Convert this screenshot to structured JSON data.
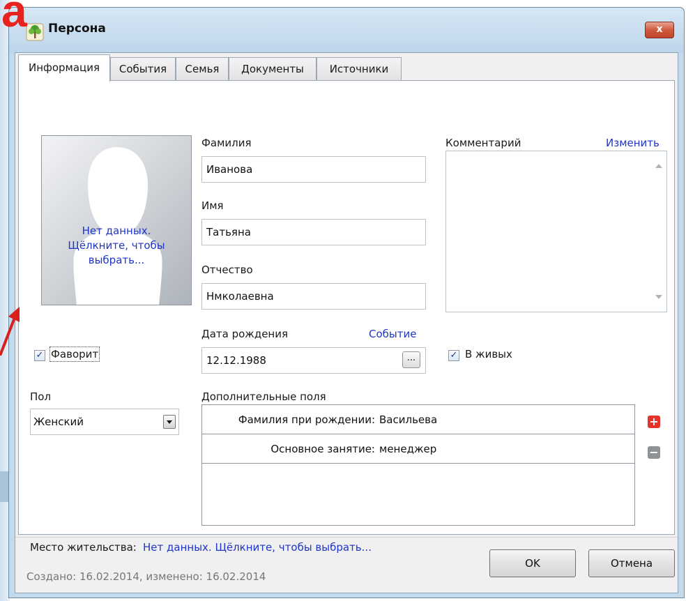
{
  "slide": {
    "corner_letter": "а"
  },
  "window": {
    "title": "Персона",
    "close_label": "x"
  },
  "tabs": [
    "Информация",
    "События",
    "Семья",
    "Документы",
    "Источники"
  ],
  "photo": {
    "line1": "Нет данных.",
    "line2": "Щёлкните, чтобы",
    "line3": "выбрать..."
  },
  "form": {
    "surname_label": "Фамилия",
    "surname_value": "Иванова",
    "name_label": "Имя",
    "name_value": "Татьяна",
    "patronymic_label": "Отчество",
    "patronymic_value": "Нмколаевна",
    "comment_label": "Комментарий",
    "comment_edit_link": "Изменить",
    "birth_label": "Дата рождения",
    "birth_event_link": "Событие",
    "birth_value": "12.12.1988",
    "birth_button": "...",
    "favorite_label": "Фаворит",
    "favorite_checked": true,
    "alive_label": "В живых",
    "alive_checked": true,
    "gender_label": "Пол",
    "gender_value": "Женский"
  },
  "extra_fields": {
    "label": "Дополнительные поля",
    "rows": [
      {
        "key": "Фамилия при рождении:",
        "value": "Васильева"
      },
      {
        "key": "Основное занятие:",
        "value": "менеджер"
      }
    ]
  },
  "residence": {
    "label": "Место жительства:",
    "link": "Нет данных. Щёлкните, чтобы выбрать..."
  },
  "footer": {
    "created_text": "Создано: 16.02.2014, изменено: 16.02.2014",
    "ok_label": "OK",
    "cancel_label": "Отмена"
  },
  "colors": {
    "link": "#1f35c8",
    "close_button": "#c1442a",
    "add_button": "#e5322b",
    "remove_button": "#8e9297",
    "slide_letter": "#e8231f"
  },
  "icons": [
    "tree-icon",
    "close-icon",
    "plus-icon",
    "minus-icon",
    "dropdown-arrow-icon",
    "checkmark-icon"
  ]
}
